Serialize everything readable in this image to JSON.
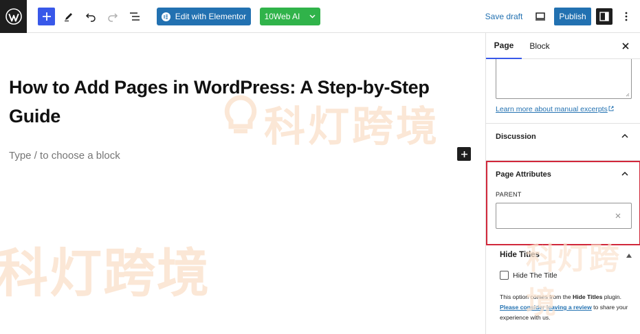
{
  "toolbar": {
    "elementor_label": "Edit with Elementor",
    "ai_label": "10Web AI",
    "save_draft_label": "Save draft",
    "publish_label": "Publish"
  },
  "editor": {
    "title": "How to Add Pages in WordPress: A Step-by-Step Guide",
    "block_placeholder": "Type / to choose a block"
  },
  "watermark": {
    "text": "科灯跨境"
  },
  "sidebar": {
    "tabs": [
      "Page",
      "Block"
    ],
    "excerpt_link": "Learn more about manual excerpts",
    "discussion_title": "Discussion",
    "page_attributes_title": "Page Attributes",
    "parent_label": "PARENT",
    "parent_value": "",
    "hide_titles": {
      "title": "Hide Titles",
      "checkbox_label": "Hide The Title",
      "desc_1": "This option comes from the ",
      "desc_plugin": "Hide Titles",
      "desc_2": " plugin. ",
      "desc_link": "Please consider leaving a review",
      "desc_3": " to share your experience with us."
    }
  },
  "colors": {
    "accent": "#3858e9",
    "link": "#2271b1",
    "ai_green": "#30b34a",
    "highlight_red": "#d1273a",
    "watermark": "#fbe3cf"
  }
}
